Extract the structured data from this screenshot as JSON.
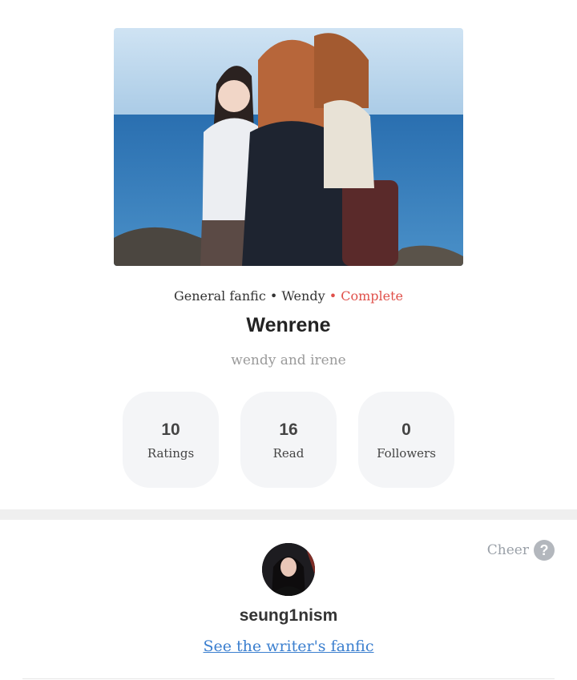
{
  "story": {
    "category": "General fanfic",
    "separator": "•",
    "character": "Wendy",
    "status": "Complete",
    "title": "Wenrene",
    "subtitle": "wendy and irene"
  },
  "stats": [
    {
      "value": "10",
      "label": "Ratings"
    },
    {
      "value": "16",
      "label": "Read"
    },
    {
      "value": "0",
      "label": "Followers"
    }
  ],
  "author": {
    "cheer_label": "Cheer",
    "help_icon": "question-icon",
    "name": "seung1nism",
    "link_text": "See the writer's fanfic"
  },
  "colors": {
    "status": "#e0504a",
    "link": "#3b7fcf",
    "stat_bg": "#f4f5f7"
  }
}
